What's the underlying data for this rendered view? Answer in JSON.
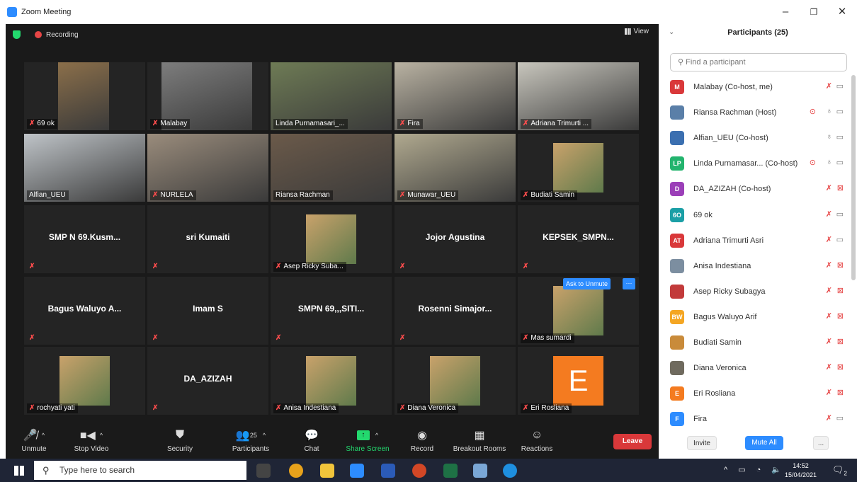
{
  "window": {
    "title": "Zoom Meeting"
  },
  "meeting": {
    "recording_label": "Recording",
    "view_label": "View",
    "ask_to_unmute": "Ask to Unmute",
    "tiles": [
      {
        "name": "69 ok",
        "mode": "video"
      },
      {
        "name": "Malabay",
        "mode": "video"
      },
      {
        "name": "Linda Purnamasari_...",
        "mode": "video",
        "active": true
      },
      {
        "name": "Fira",
        "mode": "video"
      },
      {
        "name": "Adriana Trimurti ...",
        "mode": "video"
      },
      {
        "name": "Alfian_UEU",
        "mode": "video"
      },
      {
        "name": "NURLELA",
        "mode": "video"
      },
      {
        "name": "Riansa Rachman",
        "mode": "video"
      },
      {
        "name": "Munawar_UEU",
        "mode": "video"
      },
      {
        "name": "Budiati Samin",
        "mode": "photo"
      },
      {
        "name": "SMP N 69.Kusm...",
        "mode": "name"
      },
      {
        "name": "sri Kumaiti",
        "mode": "name"
      },
      {
        "name": "Asep Ricky Suba...",
        "mode": "photo"
      },
      {
        "name": "Jojor Agustina",
        "mode": "name"
      },
      {
        "name": "KEPSEK_SMPN...",
        "mode": "name"
      },
      {
        "name": "Bagus Waluyo A...",
        "mode": "name"
      },
      {
        "name": "Imam S",
        "mode": "name"
      },
      {
        "name": "SMPN 69,,,SITI...",
        "mode": "name"
      },
      {
        "name": "Rosenni Simajor...",
        "mode": "name"
      },
      {
        "name": "Mas sumardi",
        "mode": "photo"
      },
      {
        "name": "rochyati yati",
        "mode": "photo"
      },
      {
        "name": "DA_AZIZAH",
        "mode": "name"
      },
      {
        "name": "Anisa Indestiana",
        "mode": "photo"
      },
      {
        "name": "Diana Veronica",
        "mode": "photo"
      },
      {
        "name": "Eri Rosliana",
        "mode": "letter",
        "letter": "E"
      }
    ]
  },
  "toolbar": {
    "unmute": "Unmute",
    "stop_video": "Stop Video",
    "security": "Security",
    "participants": "Participants",
    "participants_count": "25",
    "chat": "Chat",
    "share_screen": "Share Screen",
    "record": "Record",
    "breakout_rooms": "Breakout Rooms",
    "reactions": "Reactions",
    "leave": "Leave"
  },
  "panel": {
    "title": "Participants (25)",
    "search_placeholder": "Find a participant",
    "invite": "Invite",
    "mute_all": "Mute All",
    "more": "...",
    "participants": [
      {
        "name": "Malabay (Co-host, me)",
        "initials": "M",
        "color": "#d9383a",
        "mic": "off",
        "cam": "on",
        "rec": false
      },
      {
        "name": "Riansa Rachman (Host)",
        "initials": "",
        "color": "#5a7fa8",
        "mic": "on",
        "cam": "on",
        "rec": true
      },
      {
        "name": "Alfian_UEU (Co-host)",
        "initials": "",
        "color": "#3b6fb0",
        "mic": "on",
        "cam": "on",
        "rec": false
      },
      {
        "name": "Linda Purnamasar... (Co-host)",
        "initials": "LP",
        "color": "#23b46e",
        "mic": "on",
        "cam": "on",
        "rec": true
      },
      {
        "name": "DA_AZIZAH (Co-host)",
        "initials": "D",
        "color": "#9b3fb8",
        "mic": "off",
        "cam": "off",
        "rec": false
      },
      {
        "name": "69 ok",
        "initials": "6O",
        "color": "#1b9fa6",
        "mic": "off",
        "cam": "on",
        "rec": false
      },
      {
        "name": "Adriana Trimurti Asri",
        "initials": "AT",
        "color": "#d9383a",
        "mic": "off",
        "cam": "on",
        "rec": false
      },
      {
        "name": "Anisa Indestiana",
        "initials": "",
        "color": "#7c8ea0",
        "mic": "off",
        "cam": "off",
        "rec": false
      },
      {
        "name": "Asep Ricky Subagya",
        "initials": "",
        "color": "#c23a3a",
        "mic": "off",
        "cam": "off",
        "rec": false
      },
      {
        "name": "Bagus Waluyo Arif",
        "initials": "BW",
        "color": "#f4a623",
        "mic": "off",
        "cam": "off",
        "rec": false
      },
      {
        "name": "Budiati Samin",
        "initials": "",
        "color": "#c98b3a",
        "mic": "off",
        "cam": "off",
        "rec": false
      },
      {
        "name": "Diana Veronica",
        "initials": "",
        "color": "#6f6a5e",
        "mic": "off",
        "cam": "off",
        "rec": false
      },
      {
        "name": "Eri Rosliana",
        "initials": "E",
        "color": "#f47b20",
        "mic": "off",
        "cam": "off",
        "rec": false
      },
      {
        "name": "Fira",
        "initials": "F",
        "color": "#2D8CFF",
        "mic": "off",
        "cam": "on",
        "rec": false
      }
    ]
  },
  "taskbar": {
    "search_placeholder": "Type here to search",
    "time": "14:52",
    "date": "15/04/2021",
    "notifications": "2"
  }
}
